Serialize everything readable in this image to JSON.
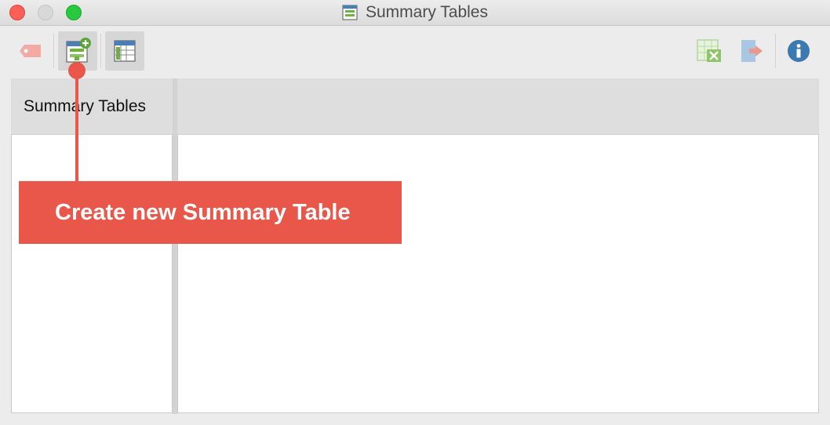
{
  "window": {
    "title": "Summary Tables"
  },
  "toolbar": {
    "left_buttons": [
      {
        "icon": "tag-icon",
        "state": "disabled"
      },
      {
        "icon": "new-summary-table-icon",
        "state": "active"
      },
      {
        "icon": "summary-table-grid-icon",
        "state": "active"
      }
    ],
    "right_buttons": [
      {
        "icon": "excel-export-icon",
        "state": "disabled"
      },
      {
        "icon": "export-arrow-icon",
        "state": "disabled"
      },
      {
        "icon": "info-icon",
        "state": "enabled"
      }
    ]
  },
  "left_panel": {
    "header": "Summary Tables"
  },
  "callout": {
    "text": "Create new Summary Table",
    "color": "#e8574a"
  },
  "colors": {
    "accent": "#e8574a",
    "info_blue": "#3b79b0",
    "green": "#6db33f"
  }
}
